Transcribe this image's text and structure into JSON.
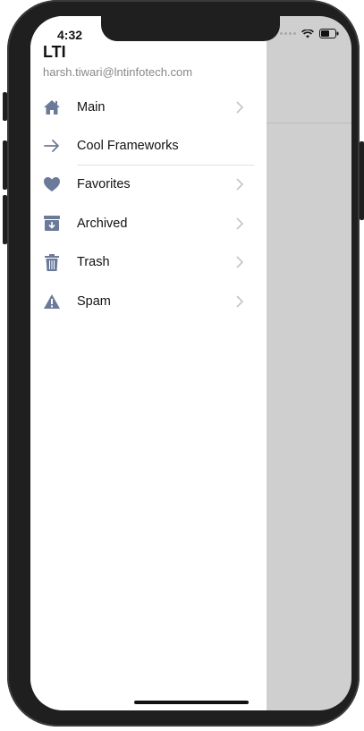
{
  "status_bar": {
    "time": "4:32"
  },
  "drawer": {
    "title": "LTI",
    "email": "harsh.tiwari@lntinfotech.com",
    "items": [
      {
        "label": "Main",
        "icon": "home-icon",
        "has_chevron": true
      },
      {
        "label": "Cool Frameworks",
        "icon": "arrow-right-icon",
        "has_chevron": false
      },
      {
        "label": "Favorites",
        "icon": "heart-icon",
        "has_chevron": true
      },
      {
        "label": "Archived",
        "icon": "archive-icon",
        "has_chevron": true
      },
      {
        "label": "Trash",
        "icon": "trash-icon",
        "has_chevron": true
      },
      {
        "label": "Spam",
        "icon": "warning-icon",
        "has_chevron": true
      }
    ]
  },
  "colors": {
    "icon": "#6b7a99",
    "chevron": "#c4c4c4",
    "overlay": "#cfcfcf"
  }
}
